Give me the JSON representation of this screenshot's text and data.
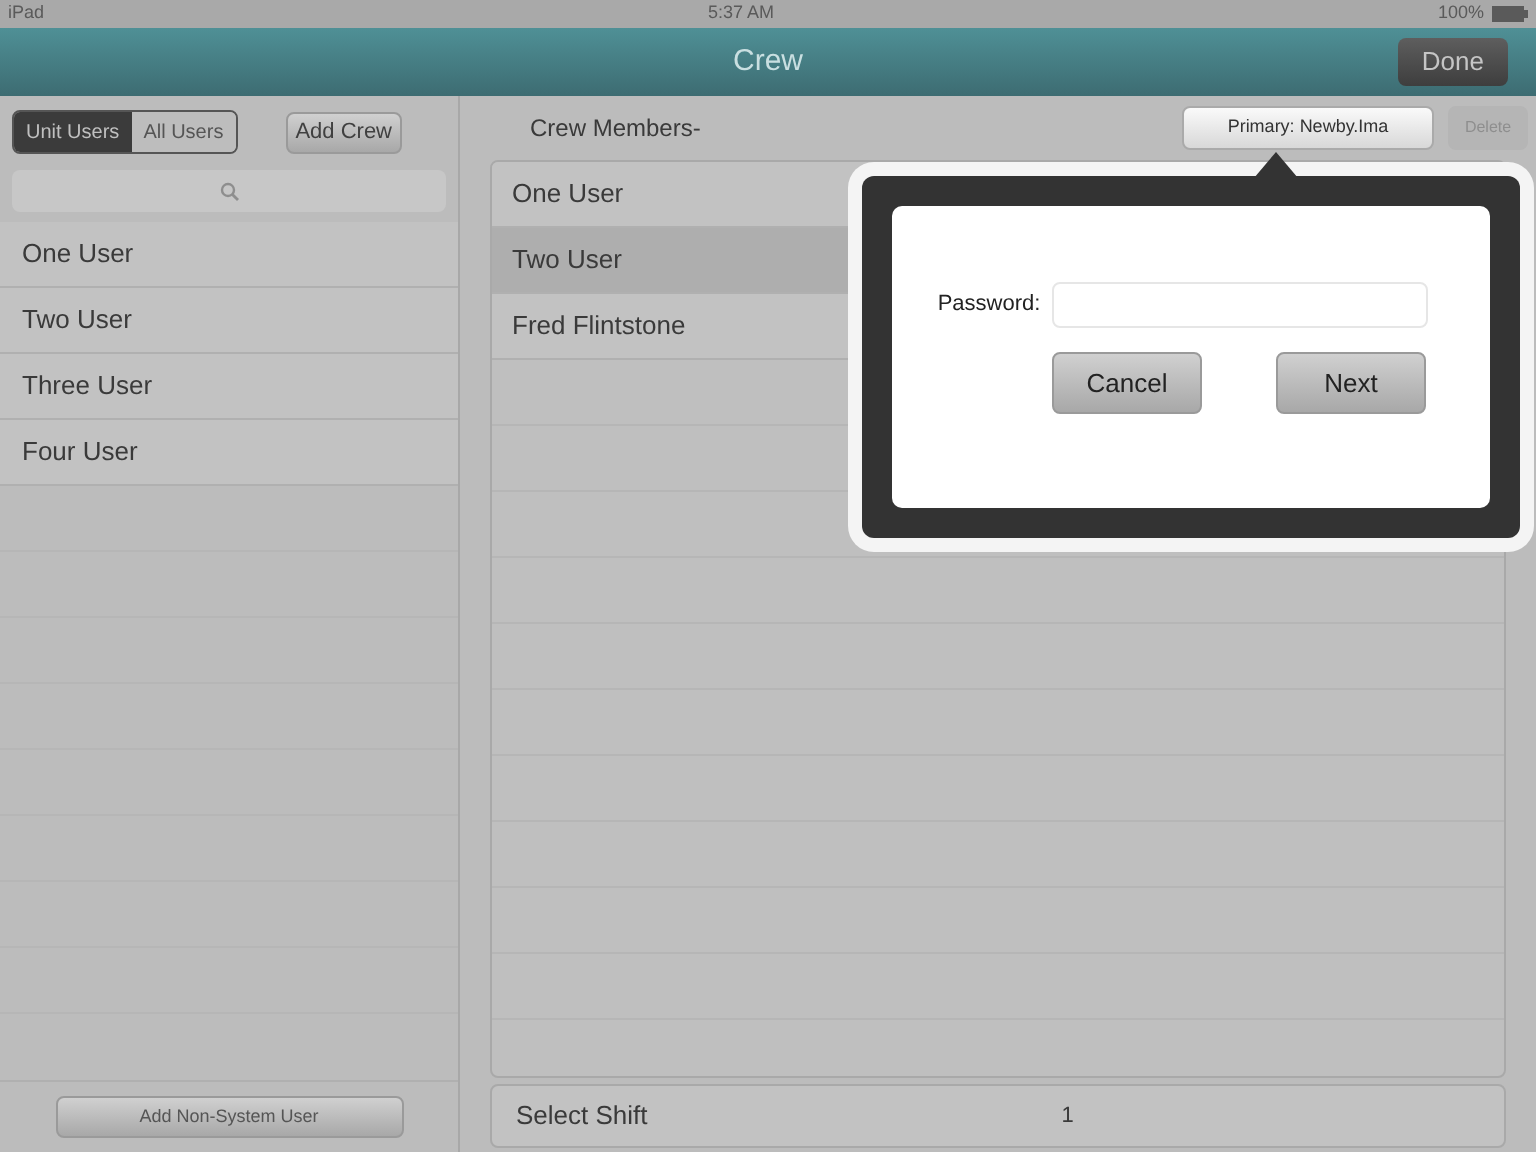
{
  "status_bar": {
    "carrier": "iPad",
    "time": "5:37 AM",
    "battery": "100%"
  },
  "nav": {
    "title": "Crew",
    "done": "Done"
  },
  "sidebar": {
    "segments": [
      {
        "label": "Unit Users",
        "selected": true
      },
      {
        "label": "All Users",
        "selected": false
      }
    ],
    "add_crew": "Add Crew",
    "users": [
      "One User",
      "Two User",
      "Three User",
      "Four User"
    ],
    "add_non_system_user": "Add Non-System User"
  },
  "crew": {
    "header": "Crew Members-",
    "primary": "Primary: Newby.Ima",
    "delete": "Delete",
    "members": [
      {
        "name": "One User",
        "selected": false
      },
      {
        "name": "Two User",
        "selected": true
      },
      {
        "name": "Fred Flintstone",
        "selected": false
      }
    ],
    "shift_label": "Select Shift",
    "shift_value": "1"
  },
  "popover": {
    "password_label": "Password:",
    "cancel": "Cancel",
    "next": "Next"
  }
}
